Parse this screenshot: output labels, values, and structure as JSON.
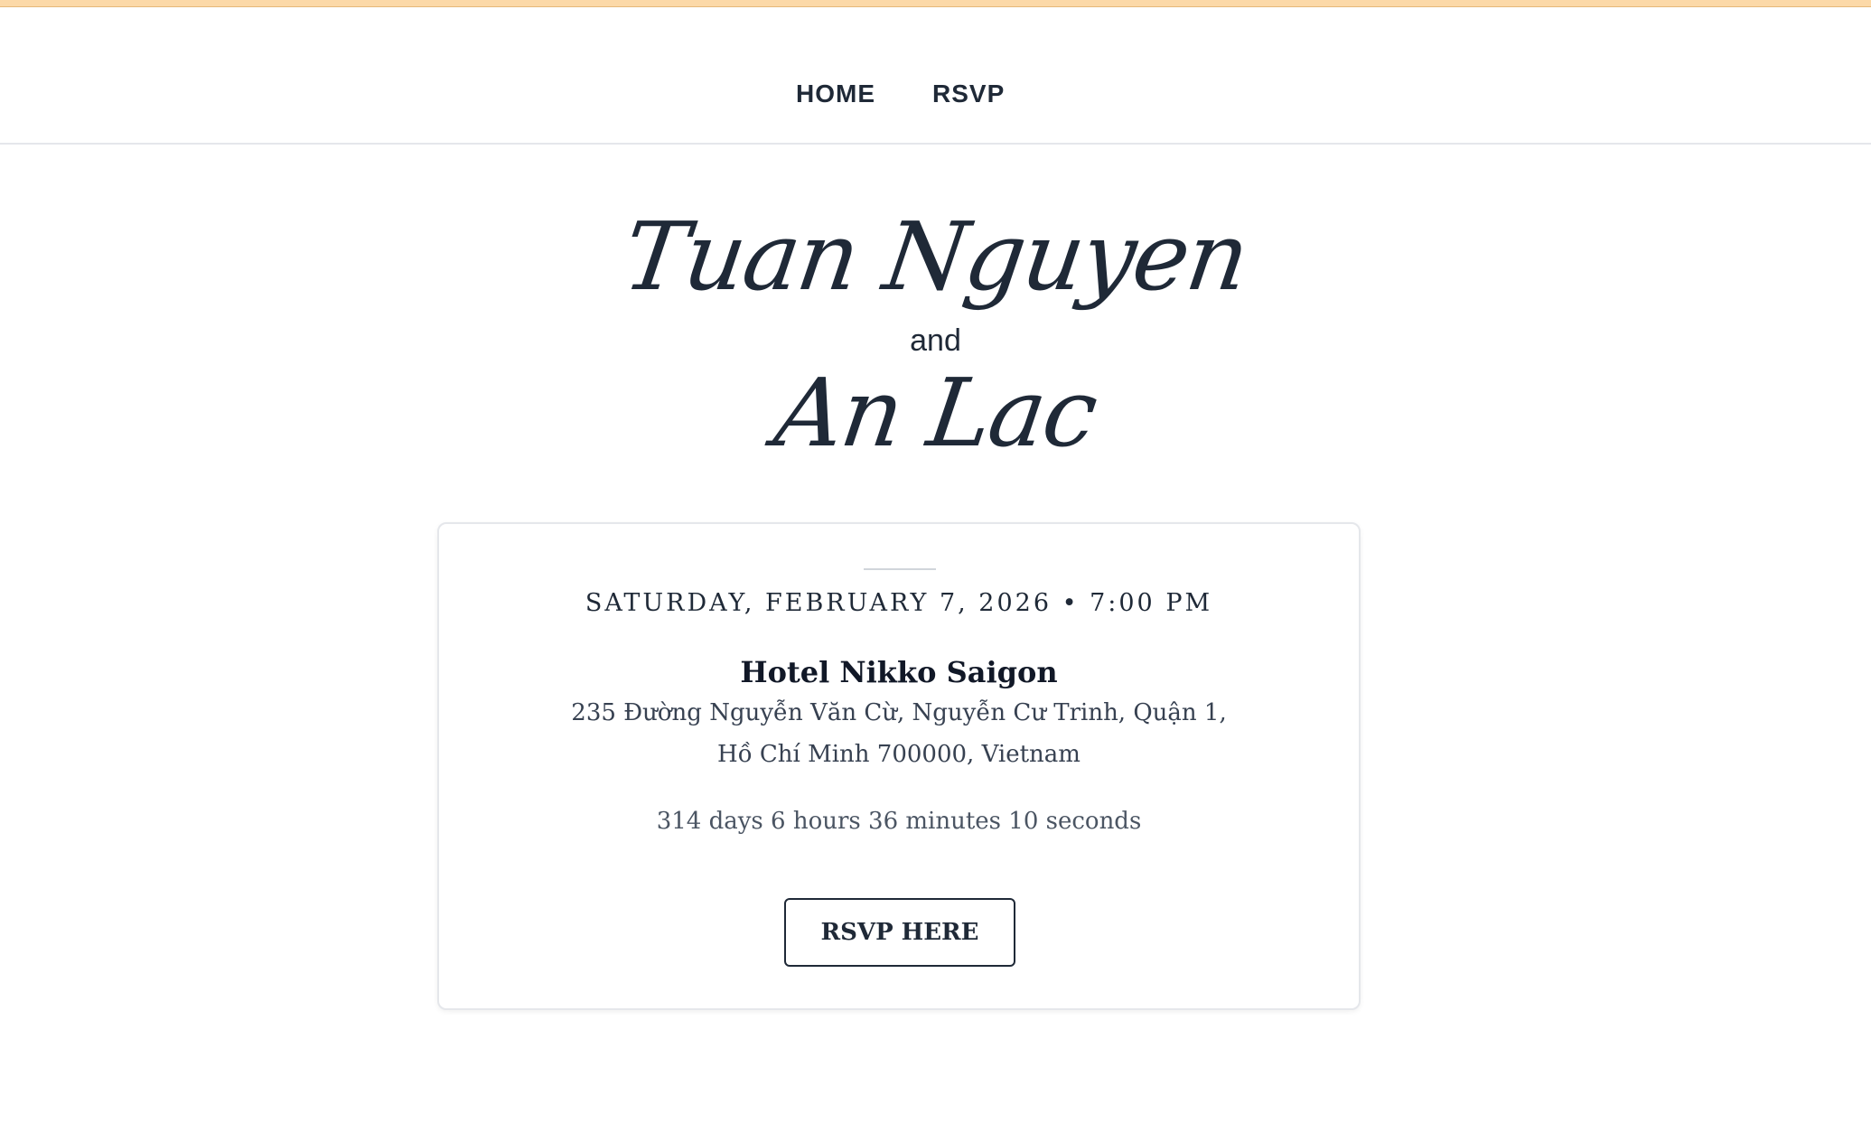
{
  "nav": {
    "items": [
      {
        "label": "HOME"
      },
      {
        "label": "RSVP"
      }
    ]
  },
  "couple": {
    "partner_1": "Tuan Nguyen",
    "connector": "and",
    "partner_2": "An Lac"
  },
  "event": {
    "date_time": "SATURDAY, FEBRUARY 7, 2026 • 7:00 PM",
    "venue_name": "Hotel Nikko Saigon",
    "address_line_1": "235 Đường Nguyễn Văn Cừ, Nguyễn Cư Trinh, Quận 1,",
    "address_line_2": "Hồ Chí Minh 700000, Vietnam",
    "countdown": "314 days 6 hours 36 minutes 10 seconds",
    "rsvp_button_label": "RSVP HERE"
  },
  "colors": {
    "accent_bar": "#fcd9a8",
    "text": "#1f2937",
    "border": "#e5e7eb"
  }
}
